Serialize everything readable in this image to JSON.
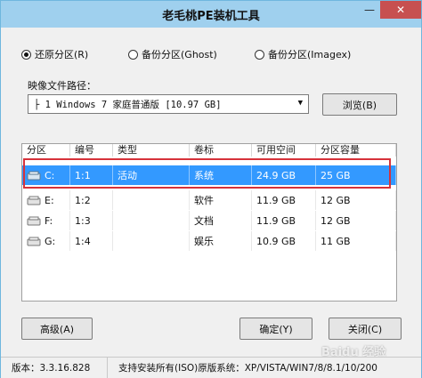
{
  "window": {
    "title": "老毛桃PE装机工具",
    "minimize_glyph": "—",
    "close_glyph": "✕"
  },
  "modes": [
    {
      "label": "还原分区(R)",
      "selected": true
    },
    {
      "label": "备份分区(Ghost)",
      "selected": false
    },
    {
      "label": "备份分区(Imagex)",
      "selected": false
    }
  ],
  "image_path": {
    "label": "映像文件路径：",
    "value": "├ 1 Windows 7 家庭普通版 [10.97 GB]",
    "browse_label": "浏览(B)"
  },
  "table": {
    "columns": [
      "分区",
      "编号",
      "类型",
      "卷标",
      "可用空间",
      "分区容量"
    ],
    "rows": [
      {
        "partition": "C:",
        "number": "1:1",
        "type": "活动",
        "label": "系统",
        "free": "24.9 GB",
        "capacity": "25 GB",
        "selected": true
      },
      {
        "partition": "E:",
        "number": "1:2",
        "type": "",
        "label": "软件",
        "free": "11.9 GB",
        "capacity": "12 GB",
        "selected": false
      },
      {
        "partition": "F:",
        "number": "1:3",
        "type": "",
        "label": "文档",
        "free": "11.9 GB",
        "capacity": "12 GB",
        "selected": false
      },
      {
        "partition": "G:",
        "number": "1:4",
        "type": "",
        "label": "娱乐",
        "free": "10.9 GB",
        "capacity": "11 GB",
        "selected": false
      }
    ]
  },
  "buttons": {
    "advanced": "高级(A)",
    "ok": "确定(Y)",
    "close": "关闭(C)"
  },
  "status": {
    "version": "版本：3.3.16.828",
    "support": "支持安装所有(ISO)原版系统：XP/VISTA/WIN7/8/8.1/10/200"
  },
  "watermark": "Baidu 经验",
  "colors": {
    "titlebar": "#9fd0ee",
    "selection": "#3399ff",
    "highlight_box": "#d6323a",
    "close_button": "#c75050"
  }
}
